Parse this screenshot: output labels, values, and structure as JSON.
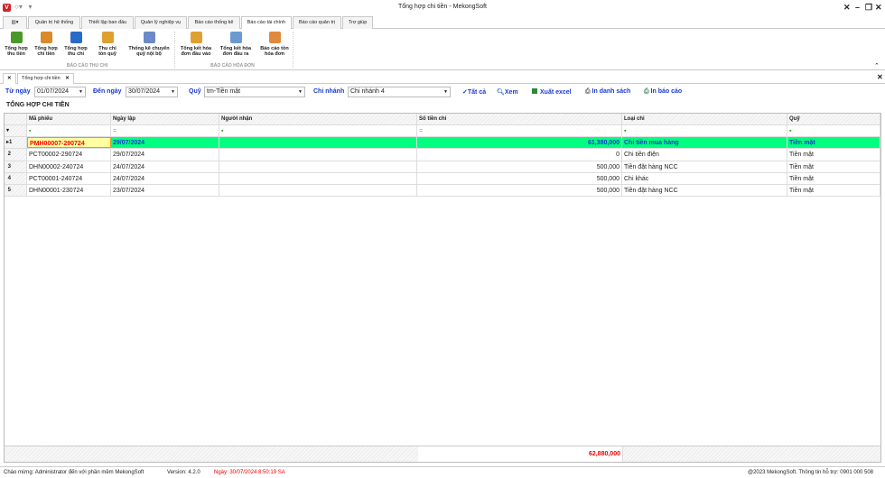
{
  "window": {
    "title": "Tổng hợp chi tiền - MekongSoft",
    "logo": "V"
  },
  "menu_tabs": [
    "Quản trị hệ thống",
    "Thiết lập ban đầu",
    "Quản lý nghiệp vụ",
    "Báo cáo thống kê",
    "Báo cáo tài chính",
    "Báo cáo quản trị",
    "Trợ giúp"
  ],
  "ribbon": {
    "buttons": [
      {
        "l1": "Tổng hợp",
        "l2": "thu tiền",
        "icon": "money-icon",
        "color": "#4a9a2a"
      },
      {
        "l1": "Tổng hợp",
        "l2": "chi tiền",
        "icon": "book-icon",
        "color": "#d98a2a"
      },
      {
        "l1": "Tổng hợp",
        "l2": "thu chi",
        "icon": "chart-icon",
        "color": "#2a6ac8"
      },
      {
        "l1": "Thu chi",
        "l2": "tồn quỹ",
        "icon": "coins-icon",
        "color": "#e0a030"
      },
      {
        "l1": "Thống kê chuyển",
        "l2": "quỹ nội bộ",
        "icon": "transfer-icon",
        "color": "#6a8ac8"
      },
      {
        "l1": "Tổng kết hóa",
        "l2": "đơn đầu vào",
        "icon": "sigma-icon",
        "color": "#e0a030"
      },
      {
        "l1": "Tổng kết hóa",
        "l2": "đơn đầu ra",
        "icon": "invoice-icon",
        "color": "#6a9ad0"
      },
      {
        "l1": "Báo cáo tồn",
        "l2": "hóa đơn",
        "icon": "report-icon",
        "color": "#e08a40"
      }
    ],
    "groups": [
      "BÁO CÁO THU CHI",
      "BÁO CÁO HÓA ĐƠN"
    ]
  },
  "doc_tab": "Tổng hợp chi tiền",
  "filters": {
    "from_label": "Từ ngày",
    "from": "01/07/2024",
    "to_label": "Đến ngày",
    "to": "30/07/2024",
    "fund_label": "Quỹ",
    "fund": "tm-Tiền mặt",
    "branch_label": "Chi nhánh",
    "branch": "Chi nhánh 4",
    "all": "Tất cả",
    "view": "Xem",
    "excel": "Xuất excel",
    "print_list": "In danh sách",
    "print_report": "In báo cáo"
  },
  "grid": {
    "title": "TỔNG HỢP CHI TIỀN",
    "columns": [
      "Mã phiếu",
      "Ngày lập",
      "Người nhận",
      "Số tiền chi",
      "Loại chi",
      "Quỹ"
    ],
    "rows": [
      {
        "n": "1",
        "ma": "PMH00007-290724",
        "ngay": "29/07/2024",
        "nguoi": "",
        "tien": "61,380,000",
        "loai": "Chi tiền mua hàng",
        "quy": "Tiền mặt"
      },
      {
        "n": "2",
        "ma": "PCT00002-290724",
        "ngay": "29/07/2024",
        "nguoi": "",
        "tien": "0",
        "loai": "Chi tiền điện",
        "quy": "Tiền mặt"
      },
      {
        "n": "3",
        "ma": "DHN00002-240724",
        "ngay": "24/07/2024",
        "nguoi": "",
        "tien": "500,000",
        "loai": "Tiền đặt hàng NCC",
        "quy": "Tiền mặt"
      },
      {
        "n": "4",
        "ma": "PCT00001-240724",
        "ngay": "24/07/2024",
        "nguoi": "",
        "tien": "500,000",
        "loai": "Chi khác",
        "quy": "Tiền mặt"
      },
      {
        "n": "5",
        "ma": "DHN00001-230724",
        "ngay": "23/07/2024",
        "nguoi": "",
        "tien": "500,000",
        "loai": "Tiền đặt hàng NCC",
        "quy": "Tiền mặt"
      }
    ],
    "total": "62,880,000"
  },
  "status": {
    "welcome": "Chào mừng: Administrator đến với phần mềm MekongSoft",
    "version": "Version: 4.2.0",
    "date": "Ngày: 30/07/2024 8:50:19 SA",
    "copyright": "@2023 MekongSoft. Thông tin hỗ trợ: 0901 000 508"
  }
}
